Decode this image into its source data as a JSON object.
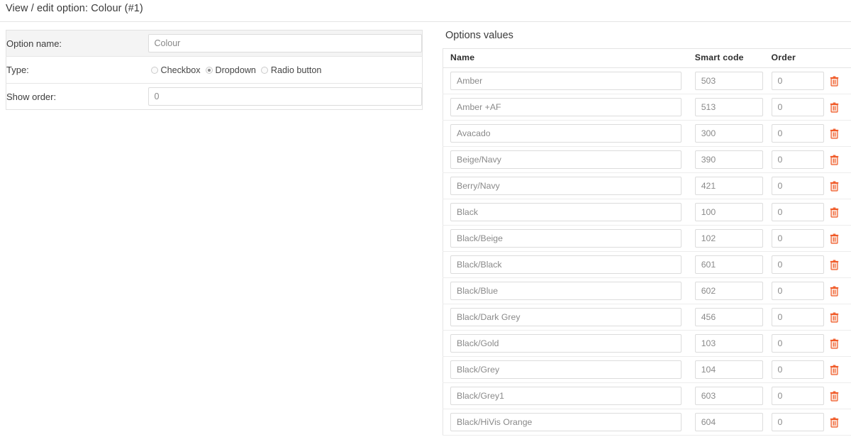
{
  "page": {
    "title": "View / edit option: Colour (#1)"
  },
  "option_form": {
    "rows": [
      {
        "label": "Option name:",
        "value": "Colour",
        "field": "text"
      },
      {
        "label": "Type:",
        "field": "radio"
      },
      {
        "label": "Show order:",
        "value": "0",
        "field": "text"
      }
    ],
    "name_label": "Option name:",
    "name_value": "Colour",
    "type_label": "Type:",
    "type_options": [
      {
        "label": "Checkbox",
        "selected": false
      },
      {
        "label": "Dropdown",
        "selected": true
      },
      {
        "label": "Radio button",
        "selected": false
      }
    ],
    "show_order_label": "Show order:",
    "show_order_value": "0"
  },
  "options_values": {
    "heading": "Options values",
    "columns": [
      "Name",
      "Smart code",
      "Order",
      ""
    ],
    "delete_icon": "trash-icon",
    "delete_icon_color": "#f05a28",
    "rows": [
      {
        "name": "Amber",
        "smart_code": "503",
        "order": "0"
      },
      {
        "name": "Amber +AF",
        "smart_code": "513",
        "order": "0"
      },
      {
        "name": "Avacado",
        "smart_code": "300",
        "order": "0"
      },
      {
        "name": "Beige/Navy",
        "smart_code": "390",
        "order": "0"
      },
      {
        "name": "Berry/Navy",
        "smart_code": "421",
        "order": "0"
      },
      {
        "name": "Black",
        "smart_code": "100",
        "order": "0"
      },
      {
        "name": "Black/Beige",
        "smart_code": "102",
        "order": "0"
      },
      {
        "name": "Black/Black",
        "smart_code": "601",
        "order": "0"
      },
      {
        "name": "Black/Blue",
        "smart_code": "602",
        "order": "0"
      },
      {
        "name": "Black/Dark Grey",
        "smart_code": "456",
        "order": "0"
      },
      {
        "name": "Black/Gold",
        "smart_code": "103",
        "order": "0"
      },
      {
        "name": "Black/Grey",
        "smart_code": "104",
        "order": "0"
      },
      {
        "name": "Black/Grey1",
        "smart_code": "603",
        "order": "0"
      },
      {
        "name": "Black/HiVis Orange",
        "smart_code": "604",
        "order": "0"
      }
    ]
  }
}
